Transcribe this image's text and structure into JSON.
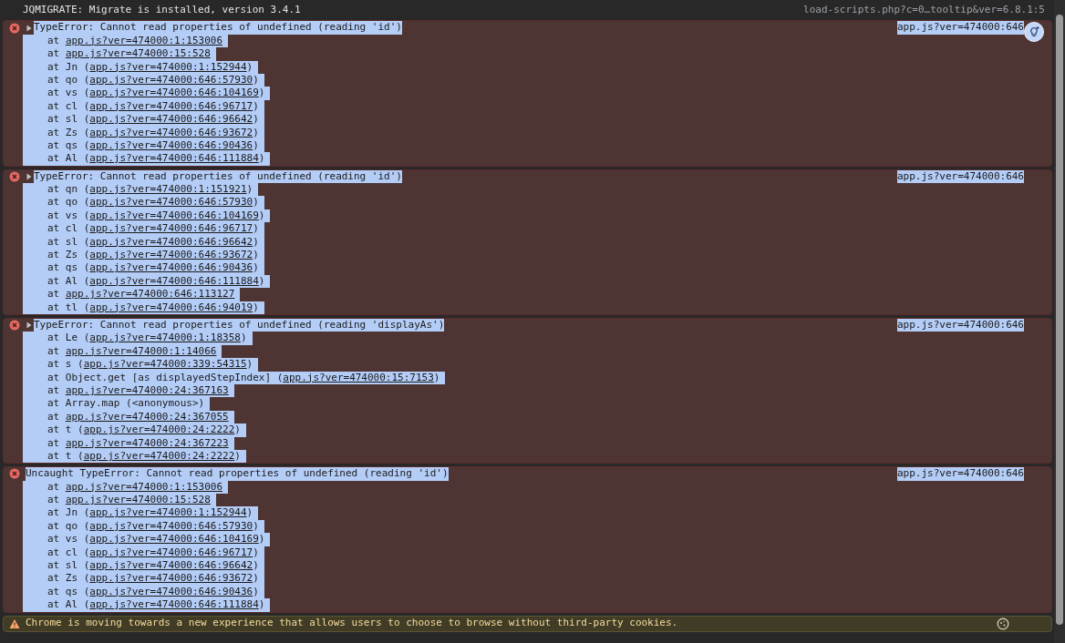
{
  "log": {
    "text": "JQMIGRATE: Migrate is installed, version 3.4.1",
    "source": "load-scripts.php?c=0…tooltip&ver=6.8.1:5"
  },
  "messages": [
    {
      "kind": "error",
      "expandable": true,
      "selected": true,
      "hint": true,
      "text": "TypeError: Cannot read properties of undefined (reading 'id')",
      "source": "app.js?ver=474000:646",
      "frames": [
        {
          "prefix": "at ",
          "link": "app.js?ver=474000:1:153006"
        },
        {
          "prefix": "at ",
          "link": "app.js?ver=474000:15:528"
        },
        {
          "prefix": "at Jn (",
          "link": "app.js?ver=474000:1:152944",
          "suffix": ")"
        },
        {
          "prefix": "at qo (",
          "link": "app.js?ver=474000:646:57930",
          "suffix": ")"
        },
        {
          "prefix": "at vs (",
          "link": "app.js?ver=474000:646:104169",
          "suffix": ")"
        },
        {
          "prefix": "at cl (",
          "link": "app.js?ver=474000:646:96717",
          "suffix": ")"
        },
        {
          "prefix": "at sl (",
          "link": "app.js?ver=474000:646:96642",
          "suffix": ")"
        },
        {
          "prefix": "at Zs (",
          "link": "app.js?ver=474000:646:93672",
          "suffix": ")"
        },
        {
          "prefix": "at qs (",
          "link": "app.js?ver=474000:646:90436",
          "suffix": ")"
        },
        {
          "prefix": "at Al (",
          "link": "app.js?ver=474000:646:111884",
          "suffix": ")"
        }
      ]
    },
    {
      "kind": "error",
      "expandable": true,
      "selected": true,
      "hint": false,
      "text": "TypeError: Cannot read properties of undefined (reading 'id')",
      "source": "app.js?ver=474000:646",
      "frames": [
        {
          "prefix": "at qn (",
          "link": "app.js?ver=474000:1:151921",
          "suffix": ")"
        },
        {
          "prefix": "at qo (",
          "link": "app.js?ver=474000:646:57930",
          "suffix": ")"
        },
        {
          "prefix": "at vs (",
          "link": "app.js?ver=474000:646:104169",
          "suffix": ")"
        },
        {
          "prefix": "at cl (",
          "link": "app.js?ver=474000:646:96717",
          "suffix": ")"
        },
        {
          "prefix": "at sl (",
          "link": "app.js?ver=474000:646:96642",
          "suffix": ")"
        },
        {
          "prefix": "at Zs (",
          "link": "app.js?ver=474000:646:93672",
          "suffix": ")"
        },
        {
          "prefix": "at qs (",
          "link": "app.js?ver=474000:646:90436",
          "suffix": ")"
        },
        {
          "prefix": "at Al (",
          "link": "app.js?ver=474000:646:111884",
          "suffix": ")"
        },
        {
          "prefix": "at ",
          "link": "app.js?ver=474000:646:113127"
        },
        {
          "prefix": "at tl (",
          "link": "app.js?ver=474000:646:94019",
          "suffix": ")"
        }
      ]
    },
    {
      "kind": "error",
      "expandable": true,
      "selected": true,
      "hint": false,
      "text": "TypeError: Cannot read properties of undefined (reading 'displayAs')",
      "source": "app.js?ver=474000:646",
      "frames": [
        {
          "prefix": "at Le (",
          "link": "app.js?ver=474000:1:18358",
          "suffix": ")"
        },
        {
          "prefix": "at ",
          "link": "app.js?ver=474000:1:14066"
        },
        {
          "prefix": "at s (",
          "link": "app.js?ver=474000:339:54315",
          "suffix": ")"
        },
        {
          "prefix": "at Object.get [as displayedStepIndex] (",
          "link": "app.js?ver=474000:15:7153",
          "suffix": ")"
        },
        {
          "prefix": "at ",
          "link": "app.js?ver=474000:24:367163"
        },
        {
          "prefix": "at Array.map (<anonymous>)"
        },
        {
          "prefix": "at ",
          "link": "app.js?ver=474000:24:367055"
        },
        {
          "prefix": "at t (",
          "link": "app.js?ver=474000:24:2222",
          "suffix": ")"
        },
        {
          "prefix": "at ",
          "link": "app.js?ver=474000:24:367223"
        },
        {
          "prefix": "at t (",
          "link": "app.js?ver=474000:24:2222",
          "suffix": ")"
        }
      ]
    },
    {
      "kind": "error",
      "expandable": false,
      "selected": true,
      "hint": false,
      "text": "Uncaught TypeError: Cannot read properties of undefined (reading 'id')",
      "source": "app.js?ver=474000:646",
      "frames": [
        {
          "prefix": "at ",
          "link": "app.js?ver=474000:1:153006"
        },
        {
          "prefix": "at ",
          "link": "app.js?ver=474000:15:528"
        },
        {
          "prefix": "at Jn (",
          "link": "app.js?ver=474000:1:152944",
          "suffix": ")"
        },
        {
          "prefix": "at qo (",
          "link": "app.js?ver=474000:646:57930",
          "suffix": ")"
        },
        {
          "prefix": "at vs (",
          "link": "app.js?ver=474000:646:104169",
          "suffix": ")"
        },
        {
          "prefix": "at cl (",
          "link": "app.js?ver=474000:646:96717",
          "suffix": ")"
        },
        {
          "prefix": "at sl (",
          "link": "app.js?ver=474000:646:96642",
          "suffix": ")"
        },
        {
          "prefix": "at Zs (",
          "link": "app.js?ver=474000:646:93672",
          "suffix": ")"
        },
        {
          "prefix": "at qs (",
          "link": "app.js?ver=474000:646:90436",
          "suffix": ")"
        },
        {
          "prefix": "at Al (",
          "link": "app.js?ver=474000:646:111884",
          "suffix": ")"
        }
      ]
    },
    {
      "kind": "warning",
      "selected": false,
      "text": "Chrome is moving towards a new experience that allows users to choose to browse without third-party cookies."
    }
  ]
}
